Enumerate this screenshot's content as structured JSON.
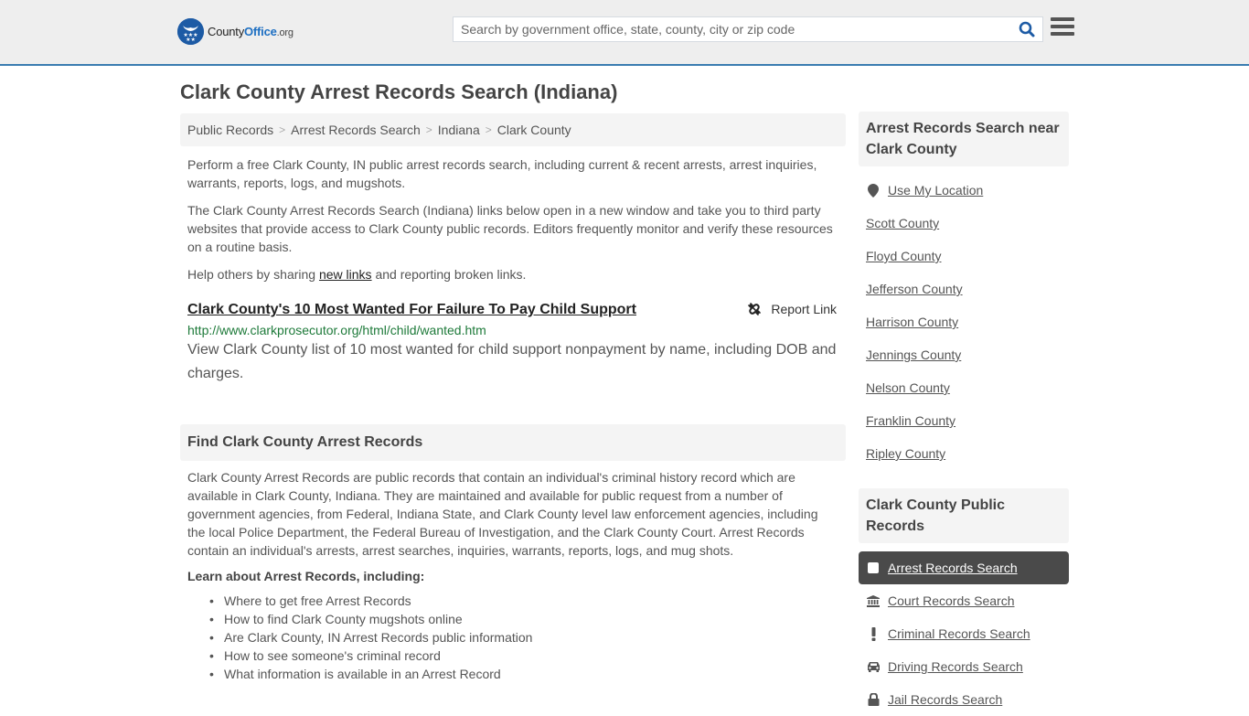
{
  "header": {
    "logo_county": "County",
    "logo_office": "Office",
    "logo_org": ".org",
    "search_placeholder": "Search by government office, state, county, city or zip code",
    "search_value": "",
    "brand_color": "#1d5ba5",
    "accent_line_color": "#3a7cb0"
  },
  "page": {
    "title": "Clark County Arrest Records Search (Indiana)"
  },
  "breadcrumb": [
    {
      "label": "Public Records"
    },
    {
      "label": "Arrest Records Search"
    },
    {
      "label": "Indiana"
    },
    {
      "label": "Clark County"
    }
  ],
  "intro": {
    "p1": "Perform a free Clark County, IN public arrest records search, including current & recent arrests, arrest inquiries, warrants, reports, logs, and mugshots.",
    "p2": "The Clark County Arrest Records Search (Indiana) links below open in a new window and take you to third party websites that provide access to Clark County public records. Editors frequently monitor and verify these resources on a routine basis.",
    "p3_before": "Help others by sharing ",
    "p3_link": "new links",
    "p3_after": " and reporting broken links."
  },
  "result": {
    "title": "Clark County's 10 Most Wanted For Failure To Pay Child Support",
    "report_label": "Report Link",
    "url": "http://www.clarkprosecutor.org/html/child/wanted.htm",
    "description": "View Clark County list of 10 most wanted for child support nonpayment by name, including DOB and charges."
  },
  "find_section": {
    "heading": "Find Clark County Arrest Records",
    "body": "Clark County Arrest Records are public records that contain an individual's criminal history record which are available in Clark County, Indiana. They are maintained and available for public request from a number of government agencies, from Federal, Indiana State, and Clark County level law enforcement agencies, including the local Police Department, the Federal Bureau of Investigation, and the Clark County Court. Arrest Records contain an individual's arrests, arrest searches, inquiries, warrants, reports, logs, and mug shots.",
    "learn_heading": "Learn about Arrest Records, including:",
    "learn_items": [
      "Where to get free Arrest Records",
      "How to find Clark County mugshots online",
      "Are Clark County, IN Arrest Records public information",
      "How to see someone's criminal record",
      "What information is available in an Arrest Record"
    ]
  },
  "sidebar": {
    "near_heading": "Arrest Records Search near Clark County",
    "use_location": "Use My Location",
    "near_items": [
      "Scott County",
      "Floyd County",
      "Jefferson County",
      "Harrison County",
      "Jennings County",
      "Nelson County",
      "Franklin County",
      "Ripley County"
    ],
    "records_heading": "Clark County Public Records",
    "records_items": [
      {
        "label": "Arrest Records Search",
        "icon": "square-icon",
        "active": true
      },
      {
        "label": "Court Records Search",
        "icon": "courthouse-icon",
        "active": false
      },
      {
        "label": "Criminal Records Search",
        "icon": "exclamation-icon",
        "active": false
      },
      {
        "label": "Driving Records Search",
        "icon": "car-icon",
        "active": false
      },
      {
        "label": "Jail Records Search",
        "icon": "lock-icon",
        "active": false
      }
    ]
  }
}
